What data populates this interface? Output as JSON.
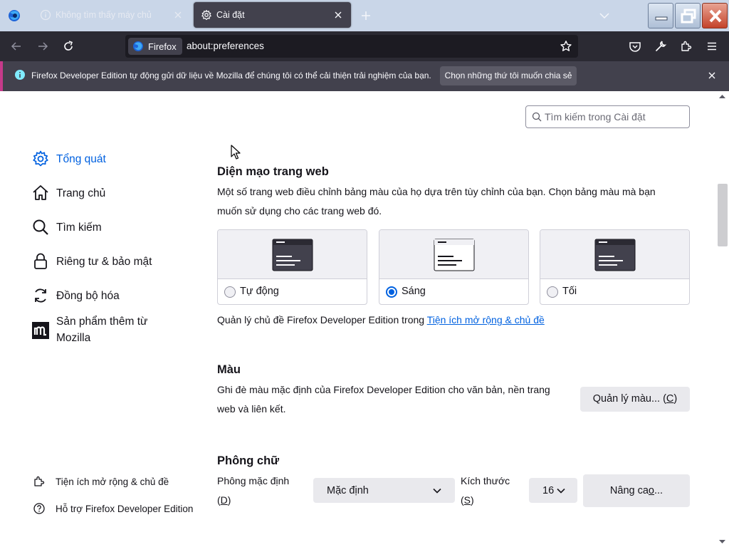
{
  "tabs": [
    {
      "label": "Không tìm thấy máy chủ",
      "icon": "info-icon",
      "active": false
    },
    {
      "label": "Cài đặt",
      "icon": "gear-icon",
      "active": true
    }
  ],
  "navbar": {
    "identity_label": "Firefox",
    "url": "about:preferences"
  },
  "notification": {
    "text": "Firefox Developer Edition tự động gửi dữ liệu về Mozilla để chúng tôi có thể cải thiện trải nghiệm của bạn.",
    "button": "Chọn những thứ tôi muốn chia sẻ"
  },
  "search": {
    "placeholder": "Tìm kiếm trong Cài đặt"
  },
  "sidebar": {
    "categories": [
      {
        "label": "Tổng quát",
        "icon": "gear-icon",
        "selected": true
      },
      {
        "label": "Trang chủ",
        "icon": "home-icon",
        "selected": false
      },
      {
        "label": "Tìm kiếm",
        "icon": "search-icon",
        "selected": false
      },
      {
        "label": "Riêng tư & bảo mật",
        "icon": "lock-icon",
        "selected": false
      },
      {
        "label": "Đồng bộ hóa",
        "icon": "sync-icon",
        "selected": false
      },
      {
        "label_line1": "Sản phẩm thêm từ",
        "label_line2": "Mozilla",
        "icon": "mozilla-icon",
        "selected": false
      }
    ],
    "footer": [
      {
        "label": "Tiện ích mở rộng & chủ đề",
        "icon": "puzzle-icon"
      },
      {
        "label": "Hỗ trợ Firefox Developer Edition",
        "icon": "help-icon"
      }
    ]
  },
  "appearance": {
    "title": "Diện mạo trang web",
    "desc_line1": "Một số trang web điều chỉnh bảng màu của họ dựa trên tùy chỉnh của bạn. Chọn bảng màu mà bạn",
    "desc_line2": "muốn sử dụng cho các trang web đó.",
    "options": [
      {
        "label": "Tự động",
        "selected": false
      },
      {
        "label": "Sáng",
        "selected": true
      },
      {
        "label": "Tối",
        "selected": false
      }
    ],
    "manage_prefix": "Quản lý chủ đề Firefox Developer Edition trong ",
    "manage_link": "Tiện ích mở rộng & chủ đề"
  },
  "colors": {
    "title": "Màu",
    "desc_line1": "Ghi đè màu mặc định của Firefox Developer Edition cho văn bản, nền trang",
    "desc_line2": "web và liên kết.",
    "button_text": "Quản lý màu... (",
    "button_key": "C",
    "button_end": ")"
  },
  "fonts": {
    "title": "Phông chữ",
    "default_label_line1": "Phông mặc định",
    "default_label_key": "D",
    "default_value": "Mặc định",
    "size_label_line1": "Kích thước",
    "size_label_key": "S",
    "size_value": "16",
    "advanced_text": "Nâng ca",
    "advanced_key": "o",
    "advanced_end": "..."
  },
  "theme": {
    "accent": "#0061e0",
    "tabstrip_bg": "#c9d6e8",
    "toolbar_bg": "#2b2a33",
    "notification_bar_color": "#c53a8a"
  }
}
